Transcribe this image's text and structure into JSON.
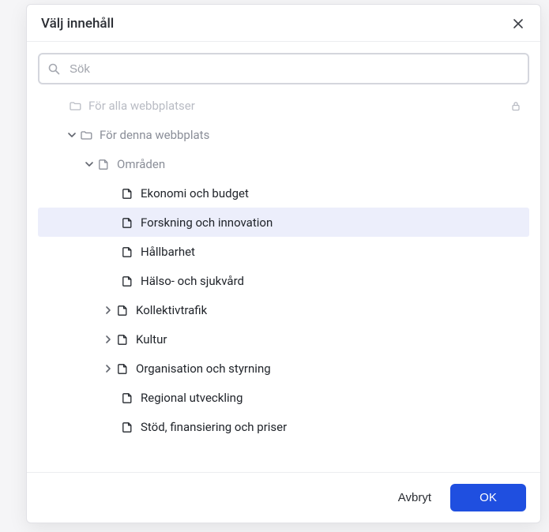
{
  "dialog": {
    "title": "Välj innehåll",
    "search_placeholder": "Sök"
  },
  "tree": {
    "root_all": {
      "label": "För alla webbplatser",
      "locked": true
    },
    "root_this": {
      "label": "För denna webbplats"
    },
    "areas": {
      "label": "Områden"
    },
    "children": [
      {
        "label": "Ekonomi och budget",
        "expandable": false,
        "selected": false
      },
      {
        "label": "Forskning och innovation",
        "expandable": false,
        "selected": true
      },
      {
        "label": "Hållbarhet",
        "expandable": false,
        "selected": false
      },
      {
        "label": "Hälso- och sjukvård",
        "expandable": false,
        "selected": false
      },
      {
        "label": "Kollektivtrafik",
        "expandable": true,
        "selected": false
      },
      {
        "label": "Kultur",
        "expandable": true,
        "selected": false
      },
      {
        "label": "Organisation och styrning",
        "expandable": true,
        "selected": false
      },
      {
        "label": "Regional utveckling",
        "expandable": false,
        "selected": false
      },
      {
        "label": "Stöd, finansiering och priser",
        "expandable": false,
        "selected": false
      }
    ]
  },
  "footer": {
    "cancel_label": "Avbryt",
    "ok_label": "OK"
  }
}
